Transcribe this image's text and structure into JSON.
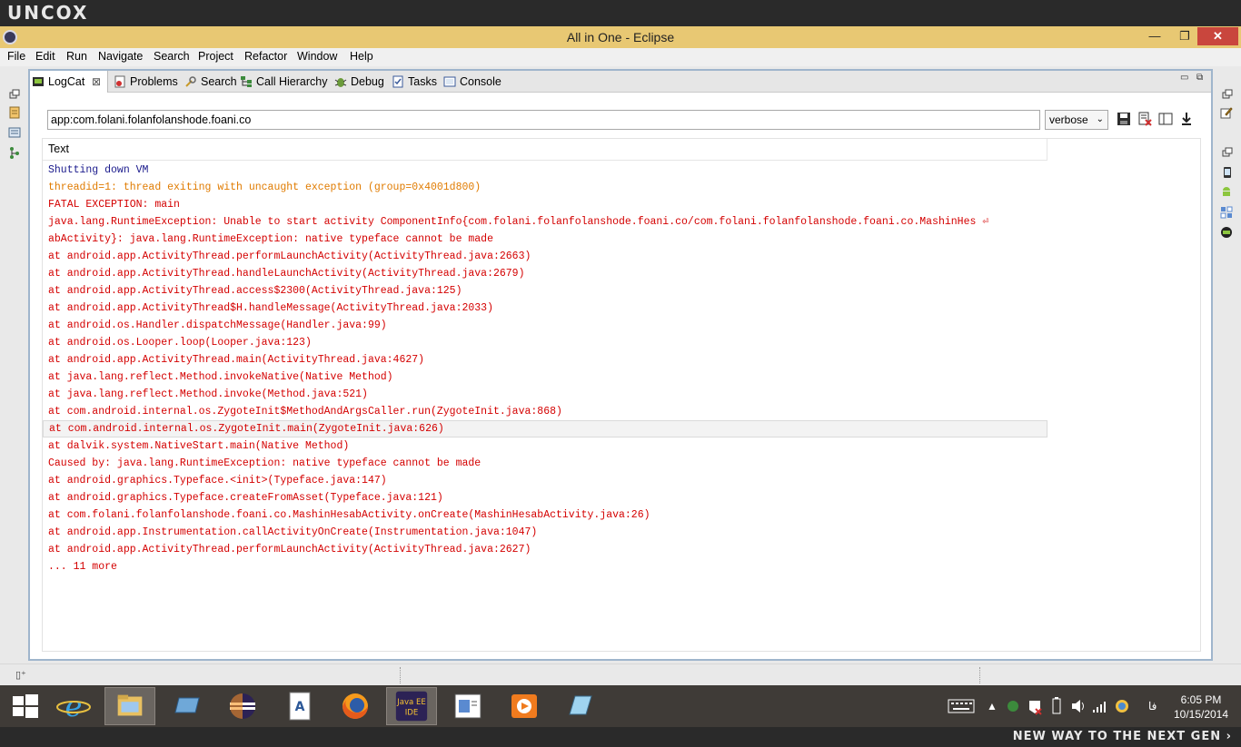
{
  "watermark": {
    "logo": "UNCOX",
    "tagline": "NEW WAY TO THE NEXT GEN ›"
  },
  "window": {
    "title": "All in One - Eclipse",
    "min": "—",
    "max": "❐",
    "close": "✕"
  },
  "menu": [
    "File",
    "Edit",
    "Run",
    "Navigate",
    "Search",
    "Project",
    "Refactor",
    "Window",
    "Help"
  ],
  "tabs": [
    {
      "label": "LogCat",
      "icon": "logcat-icon",
      "close": "⊠"
    },
    {
      "label": "Problems",
      "icon": "problems-icon"
    },
    {
      "label": "Search",
      "icon": "search-icon"
    },
    {
      "label": "Call Hierarchy",
      "icon": "call-hierarchy-icon"
    },
    {
      "label": "Debug",
      "icon": "debug-icon"
    },
    {
      "label": "Tasks",
      "icon": "tasks-icon"
    },
    {
      "label": "Console",
      "icon": "console-icon"
    }
  ],
  "filter": {
    "value": "app:com.folani.folanfolanshode.foani.co"
  },
  "level": {
    "selected": "verbose"
  },
  "log": {
    "column_header": "Text",
    "colors": {
      "info": "#1a1a8c",
      "warn": "#e07b00",
      "error": "#d40000"
    },
    "rows": [
      {
        "text": "Shutting down VM",
        "level": "info"
      },
      {
        "text": "threadid=1: thread exiting with uncaught exception (group=0x4001d800)",
        "level": "warn"
      },
      {
        "text": "FATAL EXCEPTION: main",
        "level": "error"
      },
      {
        "text": "java.lang.RuntimeException: Unable to start activity ComponentInfo{com.folani.folanfolanshode.foani.co/com.folani.folanfolanshode.foani.co.MashinHes ⏎",
        "level": "error"
      },
      {
        "text": "abActivity}: java.lang.RuntimeException: native typeface cannot be made",
        "level": "error"
      },
      {
        "text": "at android.app.ActivityThread.performLaunchActivity(ActivityThread.java:2663)",
        "level": "error"
      },
      {
        "text": "at android.app.ActivityThread.handleLaunchActivity(ActivityThread.java:2679)",
        "level": "error"
      },
      {
        "text": "at android.app.ActivityThread.access$2300(ActivityThread.java:125)",
        "level": "error"
      },
      {
        "text": "at android.app.ActivityThread$H.handleMessage(ActivityThread.java:2033)",
        "level": "error"
      },
      {
        "text": "at android.os.Handler.dispatchMessage(Handler.java:99)",
        "level": "error"
      },
      {
        "text": "at android.os.Looper.loop(Looper.java:123)",
        "level": "error"
      },
      {
        "text": "at android.app.ActivityThread.main(ActivityThread.java:4627)",
        "level": "error"
      },
      {
        "text": "at java.lang.reflect.Method.invokeNative(Native Method)",
        "level": "error"
      },
      {
        "text": "at java.lang.reflect.Method.invoke(Method.java:521)",
        "level": "error"
      },
      {
        "text": "at com.android.internal.os.ZygoteInit$MethodAndArgsCaller.run(ZygoteInit.java:868)",
        "level": "error"
      },
      {
        "text": "at com.android.internal.os.ZygoteInit.main(ZygoteInit.java:626)",
        "level": "error",
        "selected": true
      },
      {
        "text": "at dalvik.system.NativeStart.main(Native Method)",
        "level": "error"
      },
      {
        "text": "Caused by: java.lang.RuntimeException: native typeface cannot be made",
        "level": "error"
      },
      {
        "text": "at android.graphics.Typeface.<init>(Typeface.java:147)",
        "level": "error"
      },
      {
        "text": "at android.graphics.Typeface.createFromAsset(Typeface.java:121)",
        "level": "error"
      },
      {
        "text": "at com.folani.folanfolanshode.foani.co.MashinHesabActivity.onCreate(MashinHesabActivity.java:26)",
        "level": "error"
      },
      {
        "text": "at android.app.Instrumentation.callActivityOnCreate(Instrumentation.java:1047)",
        "level": "error"
      },
      {
        "text": "at android.app.ActivityThread.performLaunchActivity(ActivityThread.java:2627)",
        "level": "error"
      },
      {
        "text": "... 11 more",
        "level": "error"
      }
    ]
  },
  "taskbar": {
    "items": [
      "start-icon",
      "internet-explorer-icon",
      "file-explorer-icon",
      "window-switcher-icon",
      "eclipse-icon",
      "word-document-icon",
      "firefox-icon",
      "java-ee-ide-icon",
      "presentation-icon",
      "media-player-icon",
      "notepad-icon"
    ],
    "active_index": 7,
    "lang": "فا",
    "time": "6:05 PM",
    "date": "10/15/2014"
  }
}
